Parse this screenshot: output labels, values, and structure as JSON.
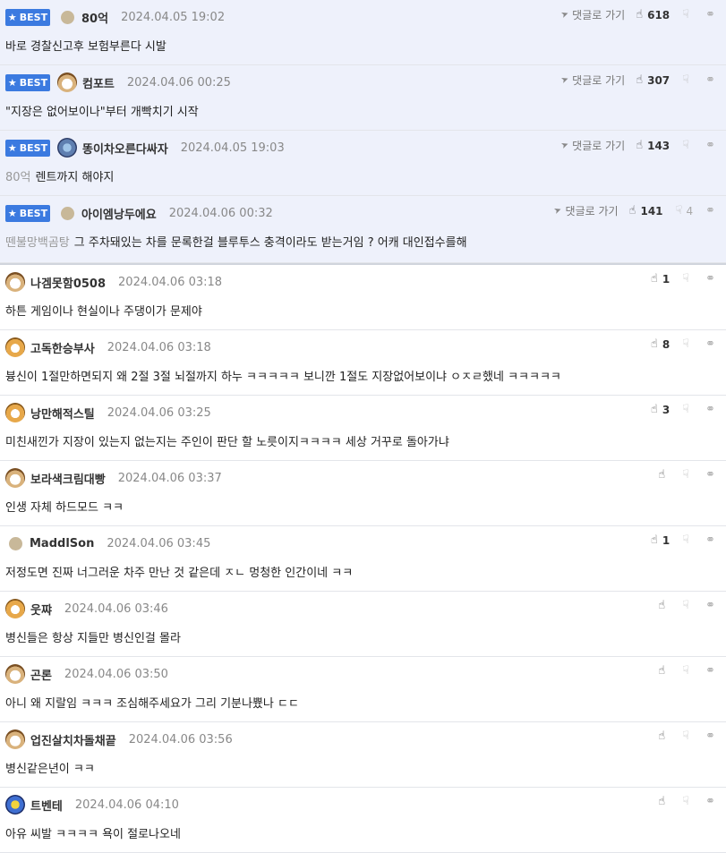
{
  "best_label": "BEST",
  "reply_label": "댓글로 가기",
  "best_comments": [
    {
      "avatar": "dot",
      "nick": "80억",
      "date": "2024.04.05 19:02",
      "quote": "",
      "text": "바로 경찰신고후 보험부른다 시발",
      "up": "618",
      "down": ""
    },
    {
      "avatar": "pup",
      "nick": "컴포트",
      "date": "2024.04.06 00:25",
      "quote": "",
      "text": "\"지장은 없어보이나\"부터 개빡치기 시작",
      "up": "307",
      "down": ""
    },
    {
      "avatar": "mixed",
      "nick": "똥이차오른다싸자",
      "date": "2024.04.05 19:03",
      "quote": "80억",
      "text": "렌트까지 해야지",
      "up": "143",
      "down": ""
    },
    {
      "avatar": "dot",
      "nick": "아이엠낭두에요",
      "date": "2024.04.06 00:32",
      "quote": "뗀불망백곰탕",
      "text": "그 주차돼있는 차를 문록한걸 블루투스 충격이라도 받는거임 ? 어캐 대인접수를해",
      "up": "141",
      "down": "4"
    }
  ],
  "comments": [
    {
      "avatar": "pup",
      "nick": "나겜못함0508",
      "date": "2024.04.06 03:18",
      "text": "하튼 게임이나 현실이나 주댕이가 문제야",
      "up": "1"
    },
    {
      "avatar": "fox",
      "nick": "고독한승부사",
      "date": "2024.04.06 03:18",
      "text": "븅신이 1절만하면되지 왜 2절 3절 뇌절까지 하누 ㅋㅋㅋㅋㅋ 보니깐 1절도 지장없어보이냐 ㅇㅈㄹ했네 ㅋㅋㅋㅋㅋ",
      "up": "8"
    },
    {
      "avatar": "fox",
      "nick": "낭만해적스틸",
      "date": "2024.04.06 03:25",
      "text": "미친새낀가 지장이 있는지 없는지는 주인이 판단 할 노릇이지ㅋㅋㅋㅋ 세상 거꾸로 돌아가냐",
      "up": "3"
    },
    {
      "avatar": "pup",
      "nick": "보라색크림대빵",
      "date": "2024.04.06 03:37",
      "text": "인생 자체 하드모드 ㅋㅋ",
      "up": ""
    },
    {
      "avatar": "dot",
      "nick": "MaddlSon",
      "date": "2024.04.06 03:45",
      "text": "저정도면 진짜 너그러운 차주 만난 것 같은데 ㅈㄴ 멍청한 인간이네 ㅋㅋ",
      "up": "1"
    },
    {
      "avatar": "fox",
      "nick": "웃쨔",
      "date": "2024.04.06 03:46",
      "text": "병신들은 항상 지들만 병신인걸 몰라",
      "up": ""
    },
    {
      "avatar": "pup",
      "nick": "곤론",
      "date": "2024.04.06 03:50",
      "text": "아니 왜 지랄임 ㅋㅋㅋ 조심해주세요가 그리 기분나쁐나 ㄷㄷ",
      "up": ""
    },
    {
      "avatar": "pup",
      "nick": "업진살치차돌채끝",
      "date": "2024.04.06 03:56",
      "text": "병신같은년이 ㅋㅋ",
      "up": ""
    },
    {
      "avatar": "eagle",
      "nick": "트벤테",
      "date": "2024.04.06 04:10",
      "text": "아유 씨발 ㅋㅋㅋㅋ 욕이 절로나오네",
      "up": ""
    }
  ]
}
